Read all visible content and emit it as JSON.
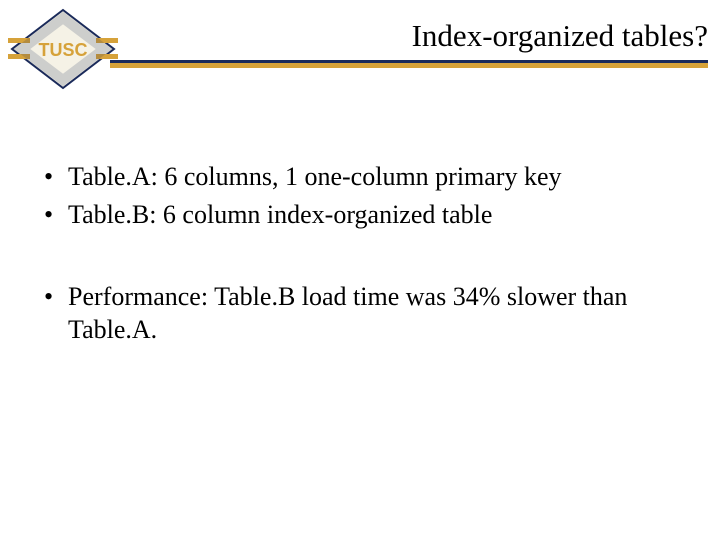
{
  "logo_text": "TUSC",
  "title": "Index-organized tables?",
  "bullets_group1": [
    "Table.A: 6 columns, 1 one-column primary key",
    "Table.B: 6 column index-organized table"
  ],
  "bullets_group2": [
    "Performance: Table.B load time was 34% slower than Table.A."
  ],
  "colors": {
    "navy": "#1a2a5a",
    "gold": "#d6a23a",
    "logo_fill": "#f5f2e6"
  }
}
